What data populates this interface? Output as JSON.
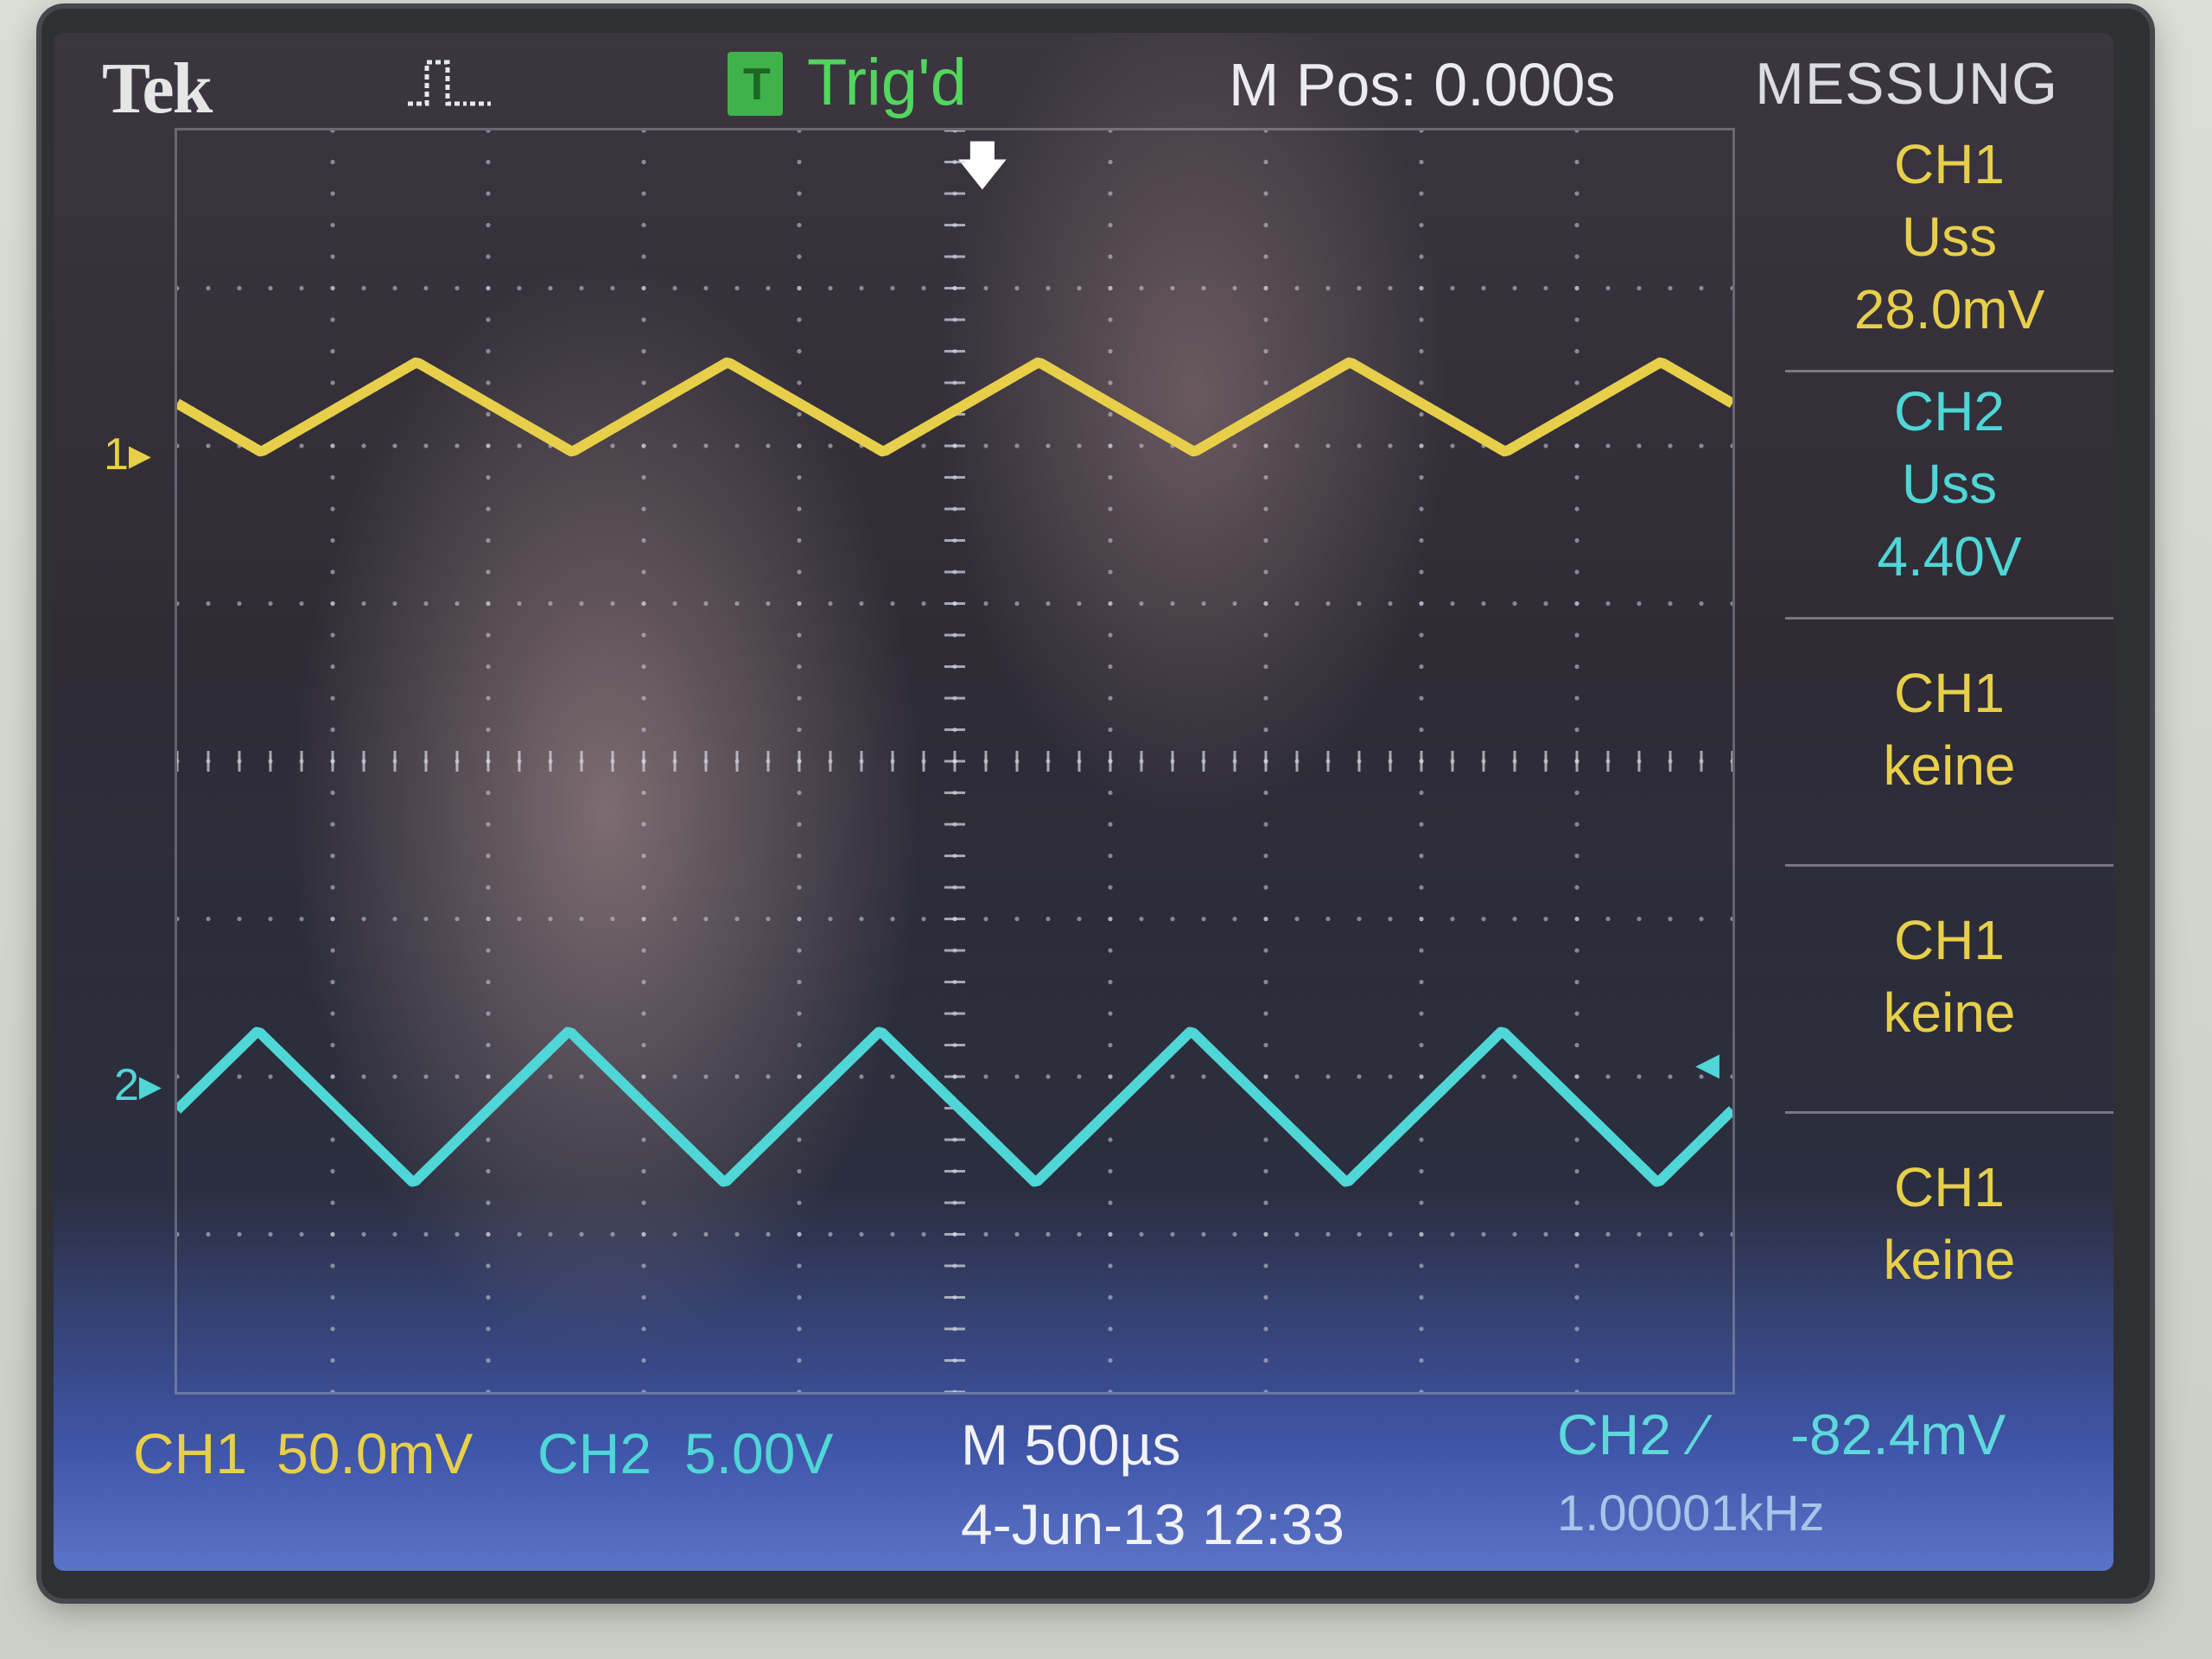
{
  "header": {
    "brand": "Tek",
    "acquisition_icon": "pulse-run-icon",
    "trigger_badge_icon": "trigger-T-icon",
    "trigger_status": "Trig'd",
    "main_position": "M Pos: 0.000s",
    "menu_title": "MESSUNG"
  },
  "channels": {
    "ch1_marker": "1",
    "ch2_marker": "2",
    "ch1_color": "#e8cf4a",
    "ch2_color": "#4fd6d6"
  },
  "side_menu": [
    {
      "source": "CH1",
      "type": "Uss",
      "value": "28.0mV",
      "color": "yellow"
    },
    {
      "source": "CH2",
      "type": "Uss",
      "value": "4.40V",
      "color": "cyan"
    },
    {
      "source": "CH1",
      "type": "keine",
      "value": "",
      "color": "yellow"
    },
    {
      "source": "CH1",
      "type": "keine",
      "value": "",
      "color": "yellow"
    },
    {
      "source": "CH1",
      "type": "keine",
      "value": "",
      "color": "yellow"
    }
  ],
  "footer": {
    "ch1_label": "CH1",
    "ch1_scale": "50.0mV",
    "ch2_label": "CH2",
    "ch2_scale": "5.00V",
    "timebase": "M 500µs",
    "date_time": "4-Jun-13 12:33",
    "trigger_source": "CH2",
    "trigger_edge_icon": "rising-edge-icon",
    "trigger_level": "-82.4mV",
    "frequency": "1.00001kHz"
  },
  "waveforms": {
    "ch1": {
      "shape": "triangle",
      "cycles": 5
    },
    "ch2": {
      "shape": "triangle",
      "cycles": 5
    }
  }
}
